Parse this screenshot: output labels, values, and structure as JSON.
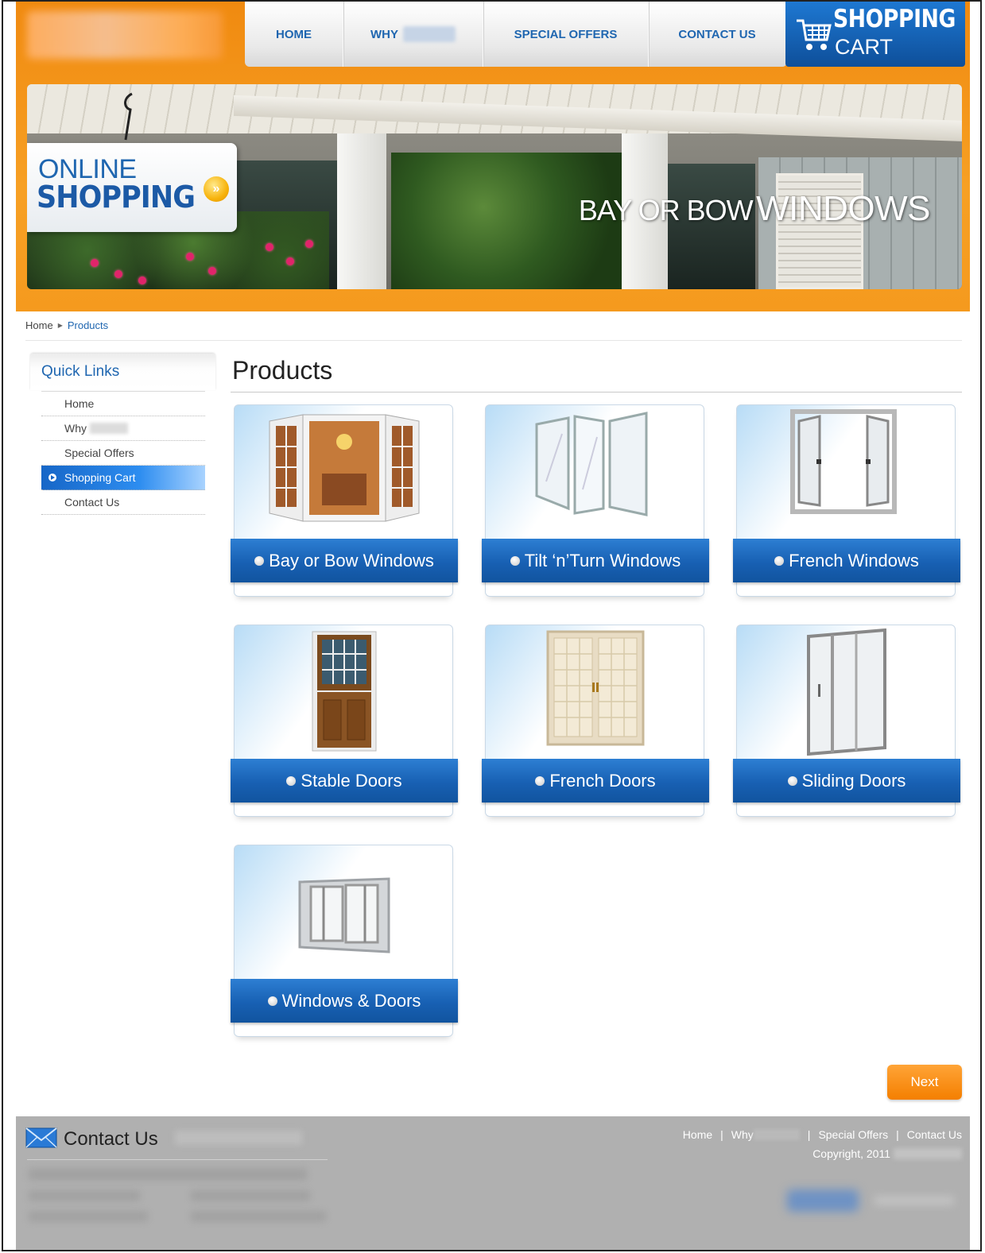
{
  "nav": {
    "items": [
      "HOME",
      "WHY",
      "SPECIAL OFFERS",
      "CONTACT US"
    ],
    "cart_title": "SHOPPING",
    "cart_sub": "CART"
  },
  "hero": {
    "promo_line1": "ONLINE",
    "promo_line2": "SHOPPING",
    "caption_small": "BAY OR BOW",
    "caption_big": "WINDOWS"
  },
  "breadcrumb": {
    "home": "Home",
    "current": "Products"
  },
  "sidebar": {
    "title": "Quick Links",
    "items": [
      {
        "label": "Home",
        "active": false
      },
      {
        "label": "Why",
        "active": false
      },
      {
        "label": "Special Offers",
        "active": false
      },
      {
        "label": "Shopping Cart",
        "active": true
      },
      {
        "label": "Contact Us",
        "active": false
      }
    ]
  },
  "main": {
    "title": "Products",
    "products": [
      {
        "label": "Bay or Bow Windows",
        "icon": "bay-window-icon"
      },
      {
        "label": "Tilt ‘n’Turn Windows",
        "icon": "tilt-turn-window-icon"
      },
      {
        "label": "French Windows",
        "icon": "french-window-icon"
      },
      {
        "label": "Stable Doors",
        "icon": "stable-door-icon"
      },
      {
        "label": "French Doors",
        "icon": "french-door-icon"
      },
      {
        "label": "Sliding Doors",
        "icon": "sliding-door-icon"
      },
      {
        "label": "Windows & Doors",
        "icon": "window-door-icon"
      }
    ],
    "next_label": "Next"
  },
  "footer": {
    "contact_title": "Contact Us",
    "links": [
      "Home",
      "Why",
      "Special Offers",
      "Contact Us"
    ],
    "copyright": "Copyright, 2011"
  },
  "colors": {
    "brand_orange": "#f7a024",
    "brand_blue": "#1860b3",
    "button_orange": "#f47f00",
    "footer_gray": "#b0b0b0"
  }
}
